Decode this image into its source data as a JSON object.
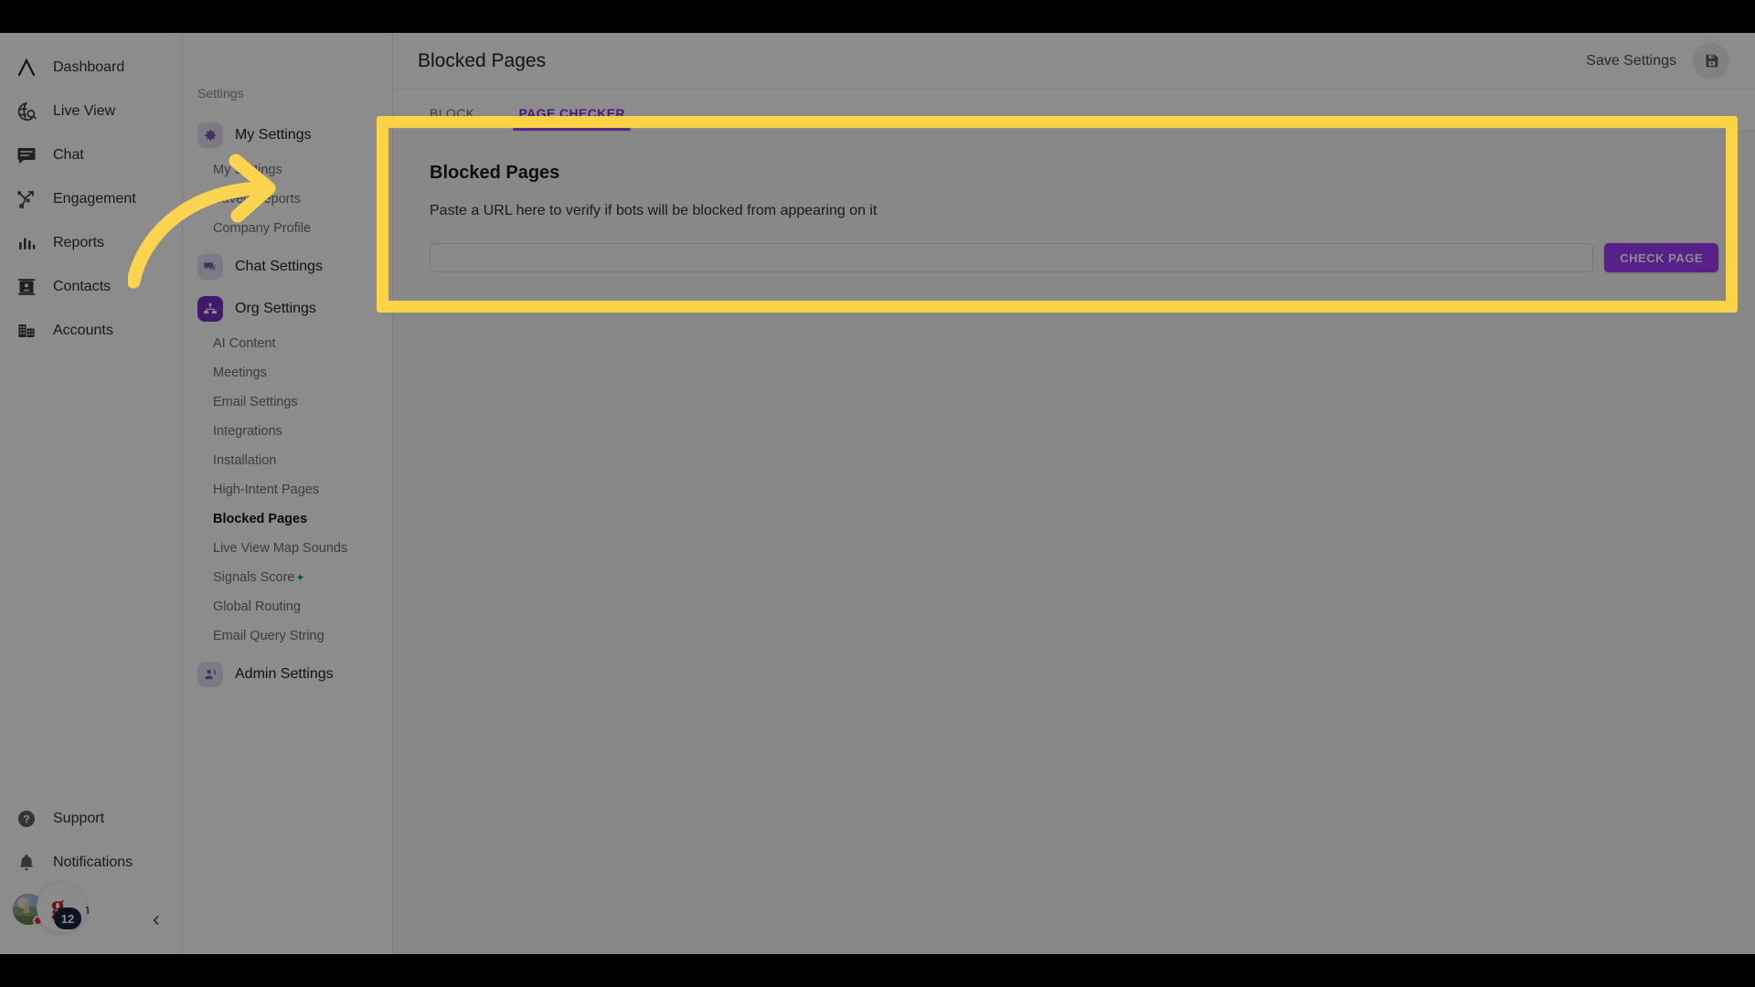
{
  "nav": {
    "items": [
      {
        "label": "Dashboard",
        "icon": "logo-chevron-icon"
      },
      {
        "label": "Live View",
        "icon": "globe-search-icon"
      },
      {
        "label": "Chat",
        "icon": "chat-bubble-icon"
      },
      {
        "label": "Engagement",
        "icon": "engagement-play-icon"
      },
      {
        "label": "Reports",
        "icon": "bar-chart-icon"
      },
      {
        "label": "Contacts",
        "icon": "contact-card-icon"
      },
      {
        "label": "Accounts",
        "icon": "building-icon"
      }
    ],
    "bottom": [
      {
        "label": "Support",
        "icon": "help-circle-icon"
      },
      {
        "label": "Notifications",
        "icon": "bell-icon"
      }
    ],
    "profile": {
      "name": "Ngan"
    },
    "badge": {
      "letter": "g.",
      "count": "12"
    },
    "collapse_icon": "chevron-left-icon"
  },
  "settings_panel": {
    "caption": "Settings",
    "groups": [
      {
        "label": "My Settings",
        "icon": "gear-icon",
        "style": "soft",
        "children": [
          {
            "label": "My Settings",
            "active": false
          },
          {
            "label": "Saved Reports",
            "active": false
          },
          {
            "label": "Company Profile",
            "active": false
          }
        ]
      },
      {
        "label": "Chat Settings",
        "icon": "chat-settings-icon",
        "style": "soft",
        "children": []
      },
      {
        "label": "Org Settings",
        "icon": "org-chart-icon",
        "style": "solid",
        "children": [
          {
            "label": "AI Content",
            "active": false
          },
          {
            "label": "Meetings",
            "active": false
          },
          {
            "label": "Email Settings",
            "active": false
          },
          {
            "label": "Integrations",
            "active": false
          },
          {
            "label": "Installation",
            "active": false
          },
          {
            "label": "High-Intent Pages",
            "active": false
          },
          {
            "label": "Blocked Pages",
            "active": true
          },
          {
            "label": "Live View Map Sounds",
            "active": false
          },
          {
            "label": "Signals Score",
            "active": false,
            "sup": "✦"
          },
          {
            "label": "Global Routing",
            "active": false
          },
          {
            "label": "Email Query String",
            "active": false
          }
        ]
      },
      {
        "label": "Admin Settings",
        "icon": "admin-user-icon",
        "style": "soft",
        "children": []
      }
    ]
  },
  "topbar": {
    "title": "Blocked Pages",
    "save_label": "Save Settings",
    "save_icon": "floppy-save-icon"
  },
  "tabs": [
    {
      "label": "BLOCK",
      "active": false
    },
    {
      "label": "PAGE CHECKER",
      "active": true
    }
  ],
  "card": {
    "title": "Blocked Pages",
    "description": "Paste a URL here to verify if bots will be blocked from appearing on it",
    "input": {
      "value": "",
      "placeholder": ""
    },
    "button_label": "CHECK PAGE"
  },
  "colors": {
    "accent_purple": "#9f3dfa",
    "org_icon_purple": "#7b2ec4",
    "highlight_yellow": "#fcd247",
    "arrow_yellow": "#fcd450",
    "tab_underline": "#a14df4",
    "badge_navy": "#14223c",
    "sup_teal": "#119c9c"
  }
}
